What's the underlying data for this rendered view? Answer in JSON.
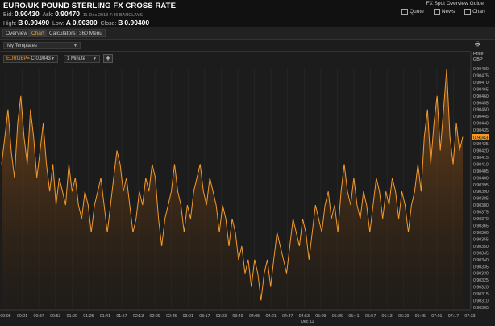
{
  "header": {
    "title": "EURO/UK POUND STERLING FX CROSS RATE",
    "guide_link": "FX Spot Overview Guide",
    "links": [
      {
        "icon": "quote-icon",
        "label": "Quote"
      },
      {
        "icon": "news-icon",
        "label": "News"
      },
      {
        "icon": "chart-icon",
        "label": "Chart"
      }
    ],
    "bid_label": "Bid:",
    "bid_value": "0.90430",
    "ask_label": "Ask:",
    "ask_value": "0.90470",
    "timestamp": "11-Dec-2018  7:46 BARCLAYS",
    "high_label": "High:",
    "high_flag": "B",
    "high_value": "0.90490",
    "low_label": "Low:",
    "low_flag": "A",
    "low_value": "0.90300",
    "close_label": "Close:",
    "close_flag": "B",
    "close_value": "0.90400"
  },
  "tabs": [
    {
      "label": "Overview",
      "active": false
    },
    {
      "label": "Chart",
      "active": true
    },
    {
      "label": "Calculators",
      "active": false
    },
    {
      "label": "360 Menu",
      "active": false
    }
  ],
  "templates": {
    "label": "My Templates"
  },
  "toolbar": {
    "symbol": "EURGBP=",
    "symbol_value": "C 0.9043",
    "interval": "1 Minute",
    "add_label": "+"
  },
  "price_axis": {
    "label1": "Price",
    "label2": "GBP",
    "current": "0.9043",
    "ticks": [
      "0.90480",
      "0.90475",
      "0.90470",
      "0.90465",
      "0.90460",
      "0.90455",
      "0.90450",
      "0.90445",
      "0.90440",
      "0.90435",
      "0.90430",
      "0.90425",
      "0.90420",
      "0.90415",
      "0.90410",
      "0.90405",
      "0.90400",
      "0.90395",
      "0.90390",
      "0.90385",
      "0.90380",
      "0.90375",
      "0.90370",
      "0.90365",
      "0.90360",
      "0.90355",
      "0.90350",
      "0.90345",
      "0.90340",
      "0.90335",
      "0.90330",
      "0.90325",
      "0.90320",
      "0.90315",
      "0.90310",
      "0.90305"
    ]
  },
  "time_axis": {
    "ticks": [
      "00:05",
      "00:21",
      "00:37",
      "00:53",
      "01:09",
      "01:25",
      "01:41",
      "01:57",
      "02:13",
      "02:29",
      "02:45",
      "03:01",
      "03:17",
      "03:33",
      "03:49",
      "04:05",
      "04:21",
      "04:37",
      "04:53",
      "05:09",
      "05:25",
      "05:41",
      "05:57",
      "06:13",
      "06:29",
      "06:45",
      "07:01",
      "07:17",
      "07:33"
    ],
    "date": "Dec 11"
  },
  "colors": {
    "line": "#f39a2c",
    "accent": "#f39a2c",
    "background": "#1c1c1c"
  },
  "chart_data": {
    "type": "area",
    "series": [
      {
        "values": [
          0.9041,
          0.9043,
          0.9045,
          0.9042,
          0.904,
          0.9044,
          0.9046,
          0.9043,
          0.9041,
          0.9045,
          0.9043,
          0.904,
          0.9042,
          0.9044,
          0.9041,
          0.9039,
          0.9041,
          0.9038,
          0.904,
          0.9039,
          0.9038,
          0.9041,
          0.9039,
          0.904,
          0.9038,
          0.9037,
          0.9039,
          0.9038,
          0.9036,
          0.9038,
          0.9039,
          0.904,
          0.9038,
          0.9036,
          0.9038,
          0.904,
          0.9042,
          0.9041,
          0.9039,
          0.904,
          0.9038,
          0.9036,
          0.9037,
          0.9039,
          0.9038,
          0.904,
          0.9039,
          0.9041,
          0.904,
          0.9037,
          0.9035,
          0.9037,
          0.9038,
          0.9039,
          0.9041,
          0.9039,
          0.9038,
          0.9036,
          0.9038,
          0.9037,
          0.9039,
          0.904,
          0.9041,
          0.9039,
          0.9038,
          0.904,
          0.9039,
          0.9038,
          0.9036,
          0.9038,
          0.9037,
          0.9035,
          0.9037,
          0.9036,
          0.9034,
          0.9035,
          0.9033,
          0.9034,
          0.9032,
          0.9034,
          0.9033,
          0.9031,
          0.9033,
          0.9034,
          0.9032,
          0.9034,
          0.9036,
          0.9035,
          0.9034,
          0.9033,
          0.9035,
          0.9037,
          0.9036,
          0.9035,
          0.9037,
          0.9036,
          0.9034,
          0.9036,
          0.9038,
          0.9037,
          0.9036,
          0.9038,
          0.9039,
          0.9037,
          0.9038,
          0.9036,
          0.9039,
          0.9041,
          0.9039,
          0.9038,
          0.904,
          0.9038,
          0.9037,
          0.9039,
          0.9038,
          0.9036,
          0.9038,
          0.904,
          0.9039,
          0.9037,
          0.9039,
          0.9038,
          0.904,
          0.9039,
          0.9037,
          0.9039,
          0.9038,
          0.9036,
          0.9038,
          0.9039,
          0.9041,
          0.9039,
          0.9043,
          0.9045,
          0.9041,
          0.9044,
          0.9046,
          0.9042,
          0.9045,
          0.9048,
          0.9043,
          0.9041,
          0.9044,
          0.9042,
          0.9043
        ],
        "min": 0.90305,
        "max": 0.9048
      }
    ],
    "yaxis_label": "Price GBP"
  }
}
